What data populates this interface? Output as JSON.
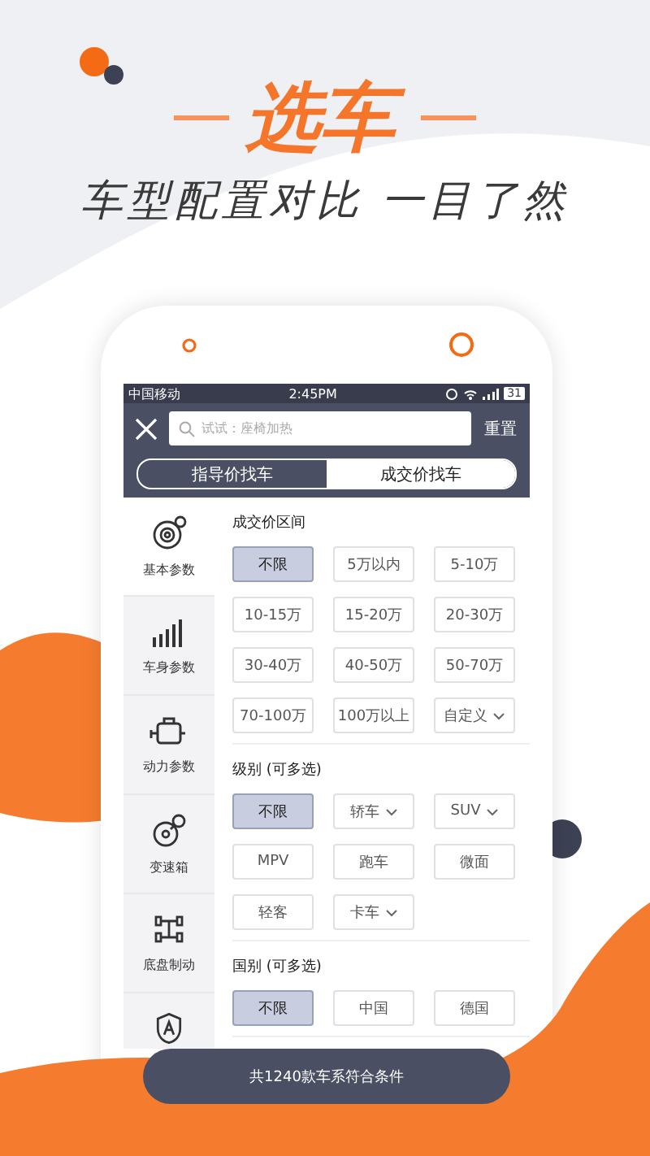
{
  "promo": {
    "title": "选车",
    "subtitle": "车型配置对比 一目了然"
  },
  "status_bar": {
    "carrier": "中国移动",
    "time": "2:45PM",
    "battery": "31"
  },
  "search": {
    "placeholder": "试试：座椅加热"
  },
  "reset_button": "重置",
  "tabs": [
    {
      "label": "指导价找车",
      "selected": false
    },
    {
      "label": "成交价找车",
      "selected": true
    }
  ],
  "sidebar": {
    "items": [
      {
        "label": "基本参数",
        "selected": true
      },
      {
        "label": "车身参数",
        "selected": false
      },
      {
        "label": "动力参数",
        "selected": false
      },
      {
        "label": "变速箱",
        "selected": false
      },
      {
        "label": "底盘制动",
        "selected": false
      },
      {
        "selected": false
      }
    ]
  },
  "sections": [
    {
      "title": "成交价区间",
      "options": [
        {
          "label": "不限",
          "selected": true,
          "caret": false
        },
        {
          "label": "5万以内",
          "selected": false,
          "caret": false
        },
        {
          "label": "5-10万",
          "selected": false,
          "caret": false
        },
        {
          "label": "10-15万",
          "selected": false,
          "caret": false
        },
        {
          "label": "15-20万",
          "selected": false,
          "caret": false
        },
        {
          "label": "20-30万",
          "selected": false,
          "caret": false
        },
        {
          "label": "30-40万",
          "selected": false,
          "caret": false
        },
        {
          "label": "40-50万",
          "selected": false,
          "caret": false
        },
        {
          "label": "50-70万",
          "selected": false,
          "caret": false
        },
        {
          "label": "70-100万",
          "selected": false,
          "caret": false
        },
        {
          "label": "100万以上",
          "selected": false,
          "caret": false
        },
        {
          "label": "自定义",
          "selected": false,
          "caret": true
        }
      ]
    },
    {
      "title": "级别 (可多选)",
      "options": [
        {
          "label": "不限",
          "selected": true,
          "caret": false
        },
        {
          "label": "轿车",
          "selected": false,
          "caret": true
        },
        {
          "label": "SUV",
          "selected": false,
          "caret": true
        },
        {
          "label": "MPV",
          "selected": false,
          "caret": false
        },
        {
          "label": "跑车",
          "selected": false,
          "caret": false
        },
        {
          "label": "微面",
          "selected": false,
          "caret": false
        },
        {
          "label": "轻客",
          "selected": false,
          "caret": false
        },
        {
          "label": "卡车",
          "selected": false,
          "caret": true
        }
      ]
    },
    {
      "title": "国别 (可多选)",
      "options": [
        {
          "label": "不限",
          "selected": true,
          "caret": false
        },
        {
          "label": "中国",
          "selected": false,
          "caret": false
        },
        {
          "label": "德国",
          "selected": false,
          "caret": false
        }
      ]
    }
  ],
  "result_bar": "共1240款车系符合条件"
}
